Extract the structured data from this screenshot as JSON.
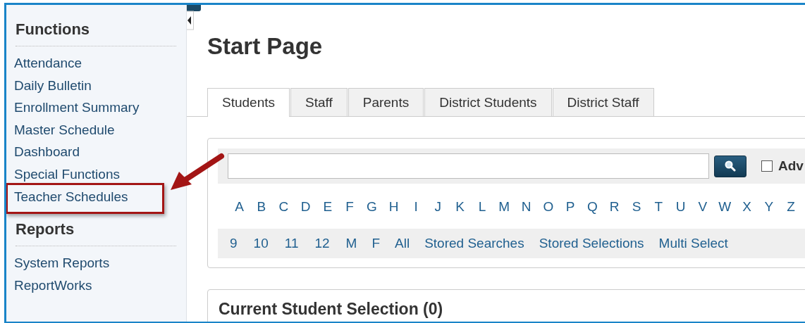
{
  "sidebar": {
    "sections": [
      {
        "heading": "Functions",
        "items": [
          {
            "label": "Attendance",
            "highlighted": false
          },
          {
            "label": "Daily Bulletin",
            "highlighted": false
          },
          {
            "label": "Enrollment Summary",
            "highlighted": false
          },
          {
            "label": "Master Schedule",
            "highlighted": false
          },
          {
            "label": "Dashboard",
            "highlighted": false
          },
          {
            "label": "Special Functions",
            "highlighted": false
          },
          {
            "label": "Teacher Schedules",
            "highlighted": true
          }
        ]
      },
      {
        "heading": "Reports",
        "items": [
          {
            "label": "System Reports",
            "highlighted": false
          },
          {
            "label": "ReportWorks",
            "highlighted": false
          }
        ]
      }
    ]
  },
  "page_title": "Start Page",
  "tabs": [
    {
      "label": "Students",
      "selected": true
    },
    {
      "label": "Staff",
      "selected": false
    },
    {
      "label": "Parents",
      "selected": false
    },
    {
      "label": "District Students",
      "selected": false
    },
    {
      "label": "District Staff",
      "selected": false
    }
  ],
  "search": {
    "checkbox": {
      "label": "Adv",
      "checked": false
    },
    "letters": [
      "A",
      "B",
      "C",
      "D",
      "E",
      "F",
      "G",
      "H",
      "I",
      "J",
      "K",
      "L",
      "M",
      "N",
      "O",
      "P",
      "Q",
      "R",
      "S",
      "T",
      "U",
      "V",
      "W",
      "X",
      "Y",
      "Z"
    ],
    "filters": [
      "9",
      "10",
      "11",
      "12",
      "M",
      "F",
      "All",
      "Stored Searches",
      "Stored Selections",
      "Multi Select"
    ]
  },
  "selection_panel": {
    "title": "Current Student Selection (0)"
  }
}
